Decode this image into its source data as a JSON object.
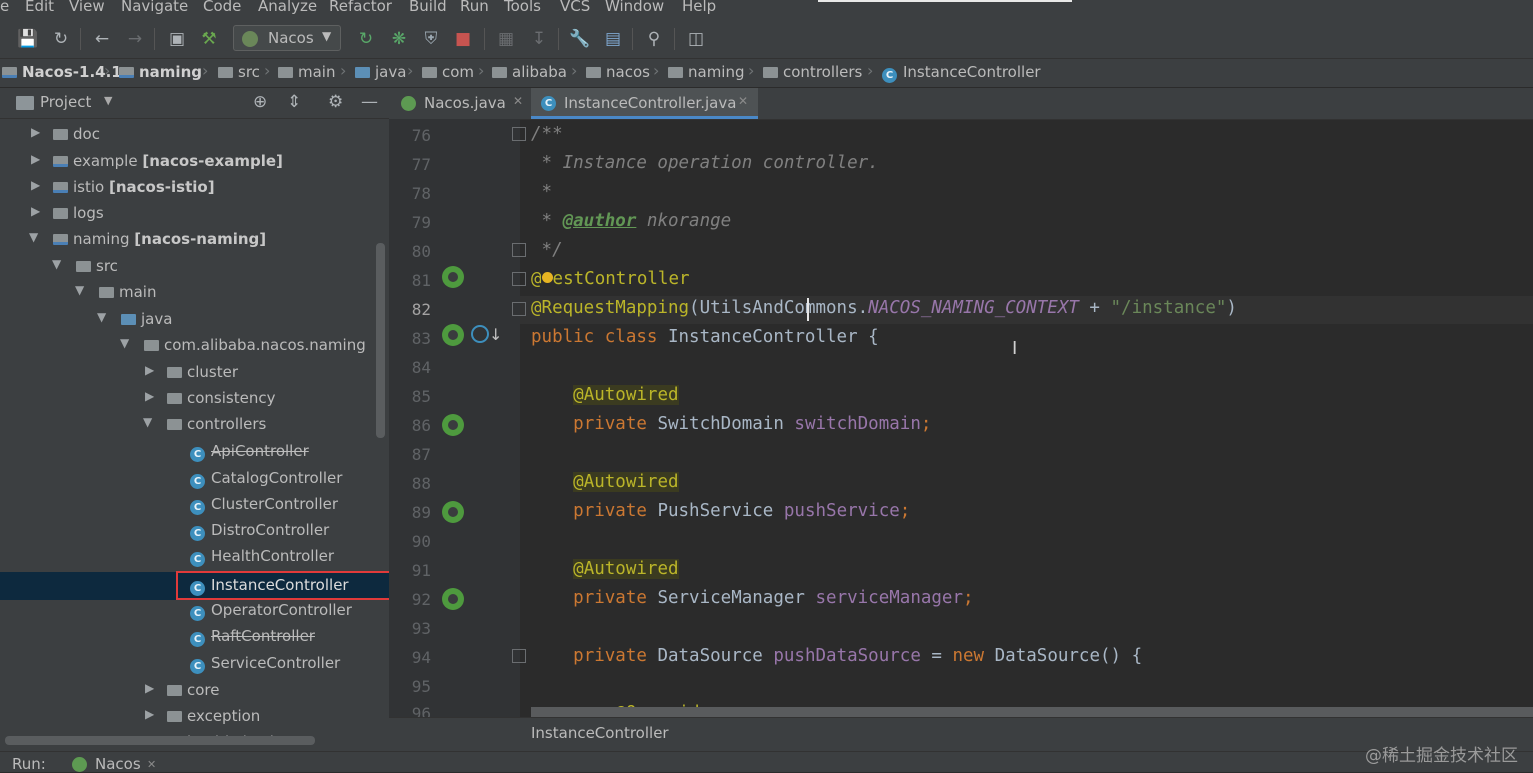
{
  "menu": [
    "e",
    "Edit",
    "View",
    "Navigate",
    "Code",
    "Analyze",
    "Refactor",
    "Build",
    "Run",
    "Tools",
    "VCS",
    "Window",
    "Help"
  ],
  "toolbar": {
    "run_config": "Nacos",
    "icons": [
      "save-all-icon",
      "sync-icon",
      "back-icon",
      "forward-icon",
      "terminal-icon",
      "build-icon",
      "run-icon",
      "debug-icon",
      "coverage-icon",
      "stop-icon",
      "vcs-update-icon",
      "vcs-commit-icon",
      "settings-wrench-icon",
      "project-structure-icon",
      "search-icon",
      "tasks-icon"
    ]
  },
  "breadcrumb": [
    "Nacos-1.4.1",
    "naming",
    "src",
    "main",
    "java",
    "com",
    "alibaba",
    "nacos",
    "naming",
    "controllers",
    "InstanceController"
  ],
  "project_panel": {
    "title": "Project",
    "tree": [
      {
        "label": "doc"
      },
      {
        "label": "example",
        "module": "[nacos-example]"
      },
      {
        "label": "istio",
        "module": "[nacos-istio]"
      },
      {
        "label": "logs"
      },
      {
        "label": "naming",
        "module": "[nacos-naming]"
      },
      {
        "label": "src"
      },
      {
        "label": "main"
      },
      {
        "label": "java"
      },
      {
        "label": "com.alibaba.nacos.naming"
      },
      {
        "label": "cluster"
      },
      {
        "label": "consistency"
      },
      {
        "label": "controllers"
      },
      {
        "label": "ApiController"
      },
      {
        "label": "CatalogController"
      },
      {
        "label": "ClusterController"
      },
      {
        "label": "DistroController"
      },
      {
        "label": "HealthController"
      },
      {
        "label": "InstanceController"
      },
      {
        "label": "OperatorController"
      },
      {
        "label": "RaftController"
      },
      {
        "label": "ServiceController"
      },
      {
        "label": "core"
      },
      {
        "label": "exception"
      },
      {
        "label": "healthcheck"
      }
    ]
  },
  "editor": {
    "tabs": [
      "Nacos.java",
      "InstanceController.java"
    ],
    "line_numbers": [
      "76",
      "77",
      "78",
      "79",
      "80",
      "81",
      "82",
      "83",
      "84",
      "85",
      "86",
      "87",
      "88",
      "89",
      "90",
      "91",
      "92",
      "93",
      "94",
      "95",
      "96"
    ],
    "code": {
      "l76": "/**",
      "l77": " * Instance operation controller.",
      "l78": " *",
      "l79_tag": "@author",
      "l79_rest": " nkorange",
      "l80": " */",
      "l81_a": "@",
      "l81_b": "estController",
      "l82_ann": "@RequestMapping",
      "l82_a": "(UtilsAndCommons.",
      "l82_const": "NACOS_NAMING_CONTEXT",
      "l82_plus": " + ",
      "l82_str": "\"/instance\"",
      "l82_close": ")",
      "l83_kw": "public class ",
      "l83_rest": "InstanceController {",
      "autowired": "@Autowired",
      "private": "private ",
      "l86_type": "SwitchDomain ",
      "l86_field": "switchDomain",
      "l89_type": "PushService ",
      "l89_field": "pushService",
      "l92_type": "ServiceManager ",
      "l92_field": "serviceManager",
      "l94_type": "DataSource ",
      "l94_field": "pushDataSource",
      "l94_eq": " = ",
      "l94_new": "new ",
      "l94_rest": "DataSource() {",
      "semicolon": ";",
      "l96": "@Override"
    },
    "bottom_breadcrumb": "InstanceController"
  },
  "runbar": {
    "label": "Run:",
    "config": "Nacos"
  },
  "watermark": "@稀土掘金技术社区"
}
